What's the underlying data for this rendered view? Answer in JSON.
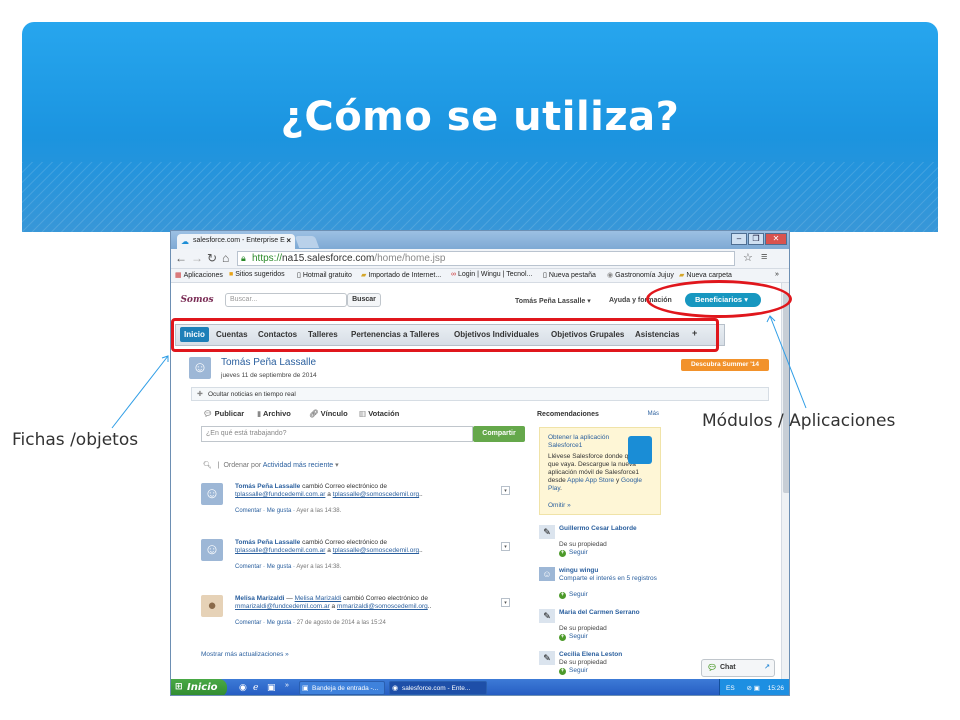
{
  "slide": {
    "title": "¿Cómo se utiliza?",
    "callout_left": "Fichas /objetos",
    "callout_right": "Módulos / Aplicaciones",
    "colors": {
      "banner": "#1d97e2",
      "annotation": "#e0161c"
    }
  },
  "browser": {
    "tab_title": "salesforce.com - Enterprise E",
    "url_scheme": "https://",
    "url_host": "na15.salesforce.com",
    "url_path": "/home/home.jsp",
    "bookmarks": [
      "Aplicaciones",
      "Sitios sugeridos",
      "Hotmail gratuito",
      "Importado de Internet...",
      "Login | Wingu | Tecnol...",
      "Nueva pestaña",
      "Gastronomía Jujuy",
      "Nueva carpeta"
    ],
    "bookmark_icons": [
      "apps-grid-icon",
      "star-bookmark-icon",
      "page-icon",
      "folder-icon",
      "wingu-logo-icon",
      "page-icon",
      "gastronomy-icon",
      "folder-icon"
    ]
  },
  "sf": {
    "logo_text": "Somos",
    "search_placeholder": "Buscar...",
    "search_button": "Buscar",
    "user_menu": "Tomás Peña Lassalle",
    "help_link": "Ayuda y formación",
    "app_menu": "Beneficiarios",
    "tabs": [
      "Inicio",
      "Cuentas",
      "Contactos",
      "Talleres",
      "Pertenencias a Talleres",
      "Objetivos Individuales",
      "Objetivos Grupales",
      "Asistencias",
      "+"
    ],
    "profile_name": "Tomás Peña Lassalle",
    "profile_date": "jueves 11 de septiembre de 2014",
    "promo_badge": "Descubra Summer '14",
    "realtime_toggle": "Ocultar noticias en tiempo real",
    "publisher": [
      "Publicar",
      "Archivo",
      "Vínculo",
      "Votación"
    ],
    "post_placeholder": "¿En qué está trabajando?",
    "share_button": "Compartir",
    "sort_label": "Ordenar por",
    "sort_value": "Actividad más reciente",
    "feed": [
      {
        "name": "Tomás Peña Lassalle",
        "action": "cambió Correo electrónico de",
        "from": "tplassalle@fundcedemil.com.ar",
        "to": "tplassalle@somoscedemil.org",
        "comment": "Comentar",
        "like": "Me gusta",
        "time": "Ayer a las 14:38."
      },
      {
        "name": "Tomás Peña Lassalle",
        "action": "cambió Correo electrónico de",
        "from": "tplassalle@fundcedemil.com.ar",
        "to": "tplassalle@somoscedemil.org",
        "comment": "Comentar",
        "like": "Me gusta",
        "time": "Ayer a las 14:38."
      },
      {
        "name": "Melisa Marizaldi",
        "sep": " — ",
        "target": "Melisa Marizaldi",
        "action": "cambió Correo electrónico de",
        "from": "mmarizaldi@fundcedemil.com.ar",
        "to": "mmarizaldi@somoscedemil.org",
        "comment": "Comentar",
        "like": "Me gusta",
        "time": "27 de agosto de 2014 a las 15:24"
      }
    ],
    "more_updates": "Mostrar más actualizaciones »",
    "recs_title": "Recomendaciones",
    "recs_more": "Más",
    "promo_link": "Obtener la aplicación Salesforce1",
    "promo_text": "Llévese Salesforce donde quiera que vaya. Descargue la nueva aplicación móvil de Salesforce1 desde",
    "promo_store1": "Apple App Store",
    "promo_y": " y ",
    "promo_store2": "Google Play",
    "promo_omit": "Omitir »",
    "recs": [
      {
        "name": "Guillermo Cesar Laborde",
        "sub": "De su propiedad",
        "follow": "Seguir"
      },
      {
        "name": "wingu wingu",
        "sub": "Comparte el interés en 5 registros",
        "follow": "Seguir"
      },
      {
        "name": "Maria del Carmen Serrano",
        "sub": "De su propiedad",
        "follow": "Seguir"
      },
      {
        "name": "Cecilia Elena Leston",
        "sub": "De su propiedad",
        "follow": "Seguir"
      }
    ],
    "chat": "Chat"
  },
  "taskbar": {
    "start": "Inicio",
    "items": [
      "Bandeja de entrada -...",
      "salesforce.com - Ente..."
    ],
    "lang": "ES",
    "clock": "15:26"
  }
}
